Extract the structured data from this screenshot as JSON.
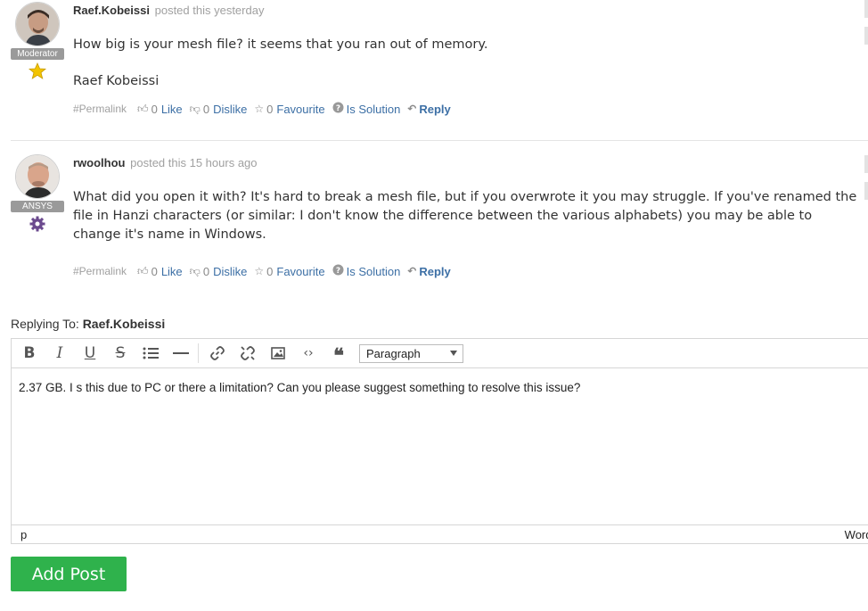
{
  "posts": [
    {
      "author": "Raef.Kobeissi",
      "posted": "posted this yesterday",
      "role": "Moderator",
      "body": [
        "How big is your mesh file? it seems that you ran out of memory.",
        "Raef Kobeissi"
      ],
      "actions": {
        "permalink": "#Permalink",
        "like_count": "0",
        "like_label": "Like",
        "dislike_count": "0",
        "dislike_label": "Dislike",
        "favourite_count": "0",
        "favourite_label": "Favourite",
        "solution_label": "Is Solution",
        "reply_label": "Reply"
      }
    },
    {
      "author": "rwoolhou",
      "posted": "posted this 15 hours ago",
      "role": "ANSYS",
      "body": [
        "What did you open it with? It's hard to break a mesh file, but if you overwrote it you may struggle. If you've renamed the file in Hanzi characters (or similar: I don't know the difference between the various alphabets) you may be able to change it's name in Windows."
      ],
      "actions": {
        "permalink": "#Permalink",
        "like_count": "0",
        "like_label": "Like",
        "dislike_count": "0",
        "dislike_label": "Dislike",
        "favourite_count": "0",
        "favourite_label": "Favourite",
        "solution_label": "Is Solution",
        "reply_label": "Reply"
      }
    }
  ],
  "reply": {
    "prefix": "Replying To:",
    "target": "Raef.Kobeissi"
  },
  "editor": {
    "format_value": "Paragraph",
    "content": "2.37 GB. I s this due to PC or there a limitation? Can you please suggest something to resolve this issue?",
    "status_path": "p",
    "status_words": "Words"
  },
  "submit_label": "Add Post",
  "colors": {
    "link": "#3c6fa5",
    "submit": "#2fb24c",
    "badge": "#9a9a9a"
  }
}
